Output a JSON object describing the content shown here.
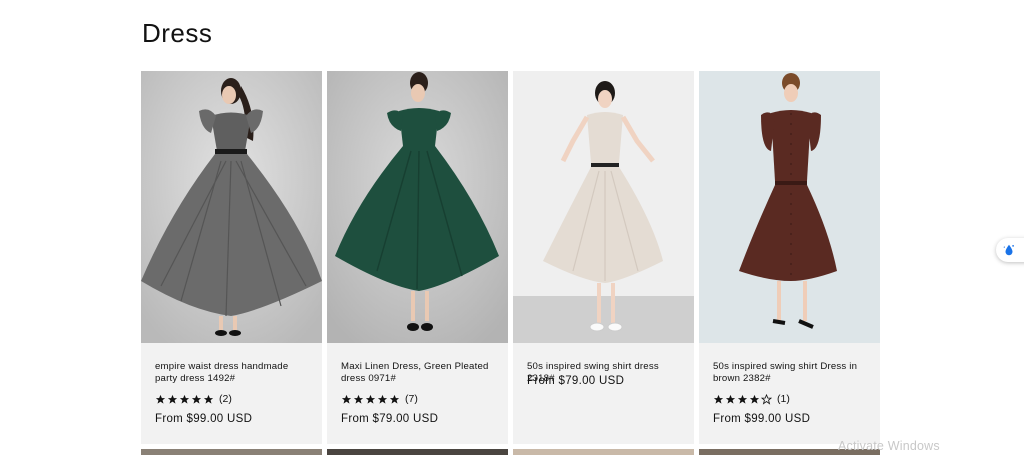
{
  "page": {
    "title": "Dress"
  },
  "products": [
    {
      "title": "empire waist dress handmade party dress 1492#",
      "stars": 5,
      "review_count": "(2)",
      "price": "From $99.00 USD",
      "image_bg": "#cfcfcf",
      "dress_color": "#6b6b6b"
    },
    {
      "title": "Maxi Linen Dress, Green Pleated dress 0971#",
      "stars": 5,
      "review_count": "(7)",
      "price": "From $79.00 USD",
      "image_bg": "#c9c9c9",
      "dress_color": "#1e4f3e"
    },
    {
      "title": "50s inspired swing shirt dress 2318#",
      "stars": 0,
      "review_count": "",
      "price": "From $79.00 USD",
      "image_bg": "#ececec",
      "dress_color": "#e4dcd3"
    },
    {
      "title": "50s inspired swing shirt Dress in brown 2382#",
      "stars": 4,
      "review_count": "(1)",
      "price": "From $99.00 USD",
      "image_bg": "#dde5e8",
      "dress_color": "#5a2a22"
    }
  ],
  "overlay": {
    "watermark": "Activate Windows",
    "widget_icon": "droplet-icon",
    "widget_color": "#1a73e8"
  }
}
